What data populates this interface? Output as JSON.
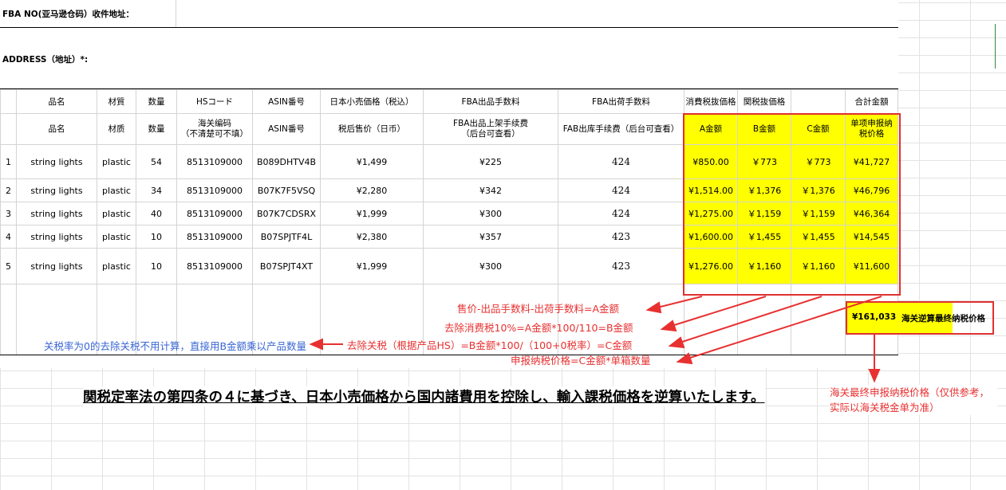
{
  "header": {
    "fba_label": "FBA NO(亚马逊仓码）收件地址：",
    "address_label": "ADDRESS（地址）*:"
  },
  "columns_ja": [
    "",
    "品名",
    "材質",
    "数量",
    "HSコード",
    "ASIN番号",
    "日本小売価格（税込）",
    "FBA出品手数料",
    "FBA出荷手数料",
    "消費税抜価格",
    "関税抜価格",
    "",
    "合計金額"
  ],
  "columns_cn": [
    "",
    "品名",
    "材质",
    "数量",
    "海关编码\n（不清楚可不填）",
    "ASIN番号",
    "税后售价（日币）",
    "FBA出品上架手续费\n（后台可查看）",
    "FAB出库手续费（后台可查看）",
    "A金额",
    "B金额",
    "C金额",
    "单项申报纳\n税价格"
  ],
  "rows": [
    [
      "1",
      "string lights",
      "plastic",
      "54",
      "8513109000",
      "B089DHTV4B",
      "¥1,499",
      "¥225",
      "424",
      "¥850.00",
      "￥773",
      "￥773",
      "¥41,727"
    ],
    [
      "2",
      "string lights",
      "plastic",
      "34",
      "8513109000",
      "B07K7F5VSQ",
      "¥2,280",
      "¥342",
      "424",
      "¥1,514.00",
      "￥1,376",
      "￥1,376",
      "¥46,796"
    ],
    [
      "3",
      "string lights",
      "plastic",
      "40",
      "8513109000",
      "B07K7CDSRX",
      "¥1,999",
      "¥300",
      "424",
      "¥1,275.00",
      "￥1,159",
      "￥1,159",
      "¥46,364"
    ],
    [
      "4",
      "string lights",
      "plastic",
      "10",
      "8513109000",
      "B07SPJTF4L",
      "¥2,380",
      "¥357",
      "423",
      "¥1,600.00",
      "￥1,455",
      "￥1,455",
      "¥14,545"
    ],
    [
      "5",
      "string lights",
      "plastic",
      "10",
      "8513109000",
      "B07SPJT4XT",
      "¥1,999",
      "¥300",
      "423",
      "¥1,276.00",
      "￥1,160",
      "￥1,160",
      "¥11,600"
    ]
  ],
  "annotations": {
    "a": "售价-出品手数料-出荷手数料=A金额",
    "b": "去除消费税10%=A金额*100/110=B金额",
    "c": "去除关税（根据产品HS）=B金额*100/（100+0税率）=C金额",
    "d": "申报纳税价格=C金额*单箱数量",
    "blue": "关税率为0的去除关税不用计算，直接用B金额乘以产品数量"
  },
  "total": {
    "value": "¥161,033",
    "label": "海关逆算最终纳税价格"
  },
  "banner": "関税定率法の第四条の４に基づき、日本小売価格から国内諸費用を控除し、輸入課税価格を逆算いたします。",
  "right_note": "海关最终申报纳税价格（仅供参考，实际以海关税金单为准）",
  "colors": {
    "highlight": "#ffff00",
    "annotation": "#e83030",
    "note_blue": "#3a66d4",
    "box": "#e03030"
  }
}
